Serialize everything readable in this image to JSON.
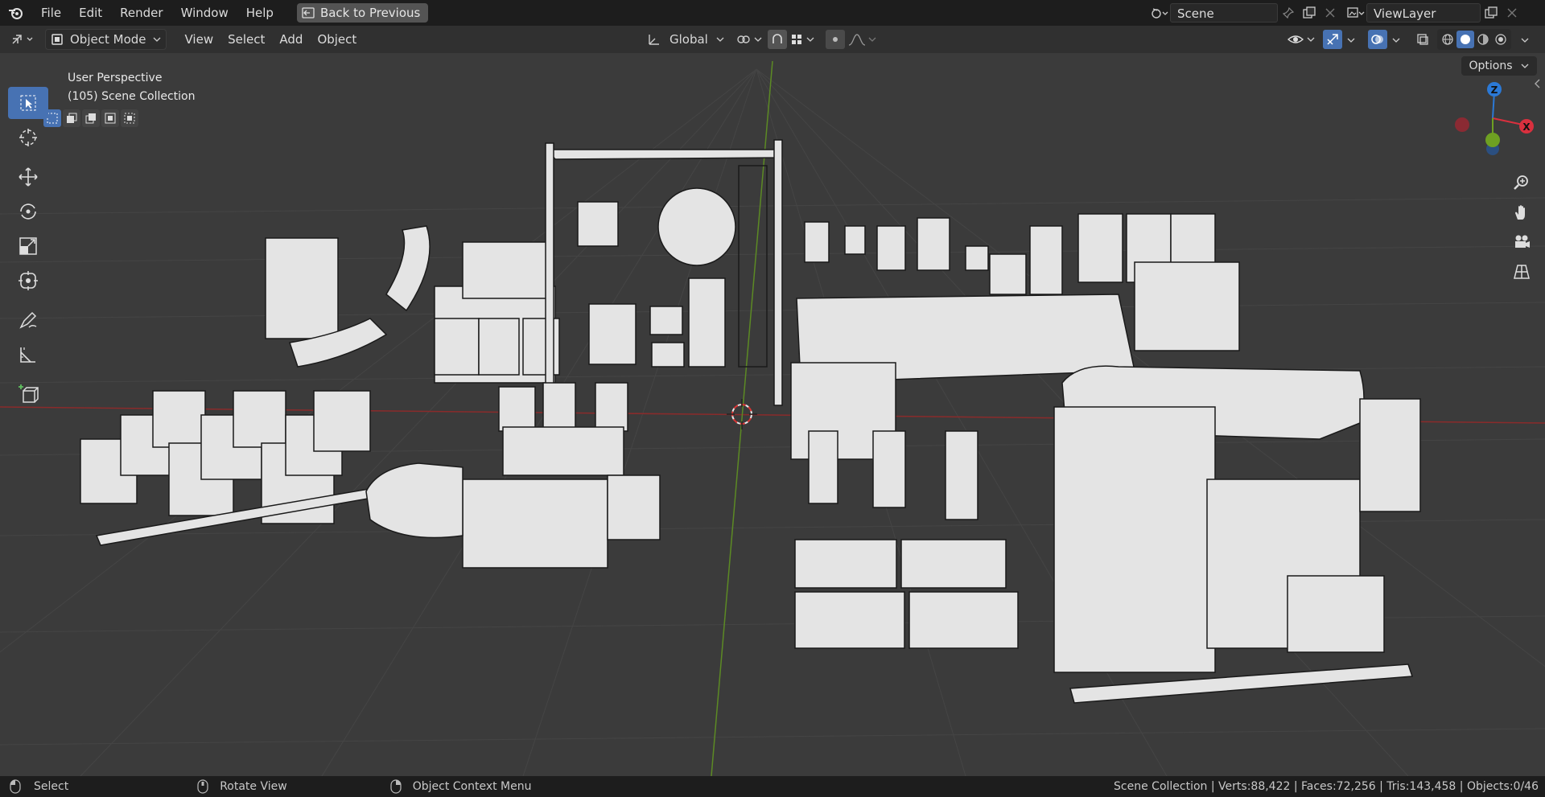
{
  "menu": {
    "file": "File",
    "edit": "Edit",
    "render": "Render",
    "window": "Window",
    "help": "Help",
    "back_to_previous": "Back to Previous"
  },
  "scene": {
    "name": "Scene",
    "view_layer": "ViewLayer"
  },
  "header": {
    "mode": "Object Mode",
    "view": "View",
    "select": "Select",
    "add": "Add",
    "object": "Object",
    "transform_orientation": "Global"
  },
  "viewport": {
    "perspective_label": "User Perspective",
    "collection_label": "(105) Scene Collection",
    "options": "Options",
    "axes": {
      "z": "Z",
      "x": "X"
    }
  },
  "status": {
    "select": "Select",
    "rotate_view": "Rotate View",
    "context_menu": "Object Context Menu",
    "stats": "Scene Collection | Verts:88,422 | Faces:72,256 | Tris:143,458 | Objects:0/46"
  },
  "colors": {
    "accent": "#4772b3",
    "x_axis": "#d9303e",
    "y_axis": "#6ea022",
    "z_axis": "#2b79d6"
  }
}
